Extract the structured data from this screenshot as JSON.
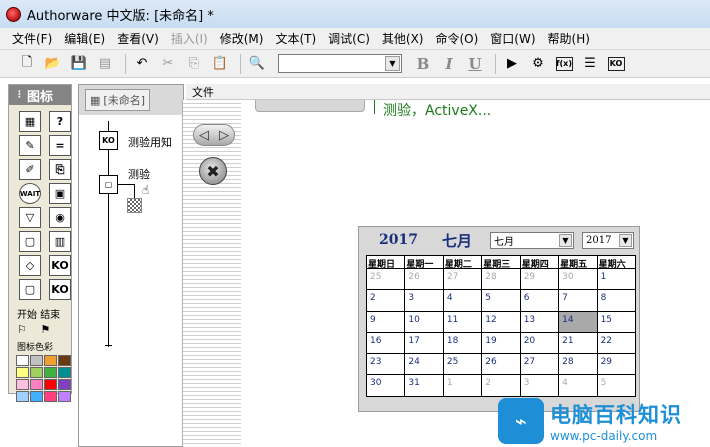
{
  "window": {
    "title": "Authorware 中文版: [未命名] *"
  },
  "menu": [
    {
      "label": "文件(F)",
      "enabled": true
    },
    {
      "label": "编辑(E)",
      "enabled": true
    },
    {
      "label": "查看(V)",
      "enabled": true
    },
    {
      "label": "插入(I)",
      "enabled": false
    },
    {
      "label": "修改(M)",
      "enabled": true
    },
    {
      "label": "文本(T)",
      "enabled": true
    },
    {
      "label": "调试(C)",
      "enabled": true
    },
    {
      "label": "其他(X)",
      "enabled": true
    },
    {
      "label": "命令(O)",
      "enabled": true
    },
    {
      "label": "窗口(W)",
      "enabled": true
    },
    {
      "label": "帮助(H)",
      "enabled": true
    }
  ],
  "toolbar": {
    "icons": [
      "new-file-icon",
      "open-file-icon",
      "save-all-icon",
      "import-icon",
      "undo-icon",
      "cut-icon",
      "copy-icon",
      "paste-icon",
      "find-icon"
    ],
    "style_select": "",
    "bold": "B",
    "italic": "I",
    "underline": "U",
    "right_icons": [
      "run-icon",
      "control-panel-icon",
      "functions-icon",
      "variables-icon",
      "knowledge-objects-icon"
    ],
    "fx_label": "f(x)",
    "ko_label": "KO"
  },
  "palette": {
    "title": "图标",
    "icons": [
      "display-icon",
      "motion-icon",
      "erase-icon",
      "wait-icon",
      "navigate-icon",
      "framework-icon",
      "decision-icon",
      "interaction-icon",
      "calculation-icon",
      "map-icon",
      "digital-movie-icon",
      "sound-icon",
      "video-icon",
      "knowledge-object-icon",
      "frame-icon",
      "ko-icon"
    ],
    "icon_glyphs": [
      "▦",
      "?",
      "✎",
      "=",
      "✐",
      "⎘",
      "WAIT",
      "▣",
      "▽",
      "◉",
      "▢",
      "▥",
      "◇",
      "KO",
      "▢",
      "KO"
    ],
    "start_label": "开始",
    "end_label": "结束",
    "color_label": "图标色彩",
    "colors": [
      "#ffffff",
      "#c0c0c0",
      "#f0a030",
      "#6a3a10",
      "#ffff80",
      "#a0d060",
      "#40b040",
      "#009090",
      "#ffc0e0",
      "#ff80c0",
      "#ff0000",
      "#8040c0",
      "#a0d0ff",
      "#40b0ff",
      "#ff4080",
      "#c080ff"
    ]
  },
  "design": {
    "tab": "[未命名]",
    "items": [
      {
        "label": "测验用知",
        "glyph": "KO"
      },
      {
        "label": "测验",
        "glyph": "▢"
      }
    ]
  },
  "file_panel_label": "文件",
  "presentation": {
    "top_text": "测验，ActiveX..."
  },
  "calendar": {
    "year": "2017",
    "month": "七月",
    "month_select": "七月",
    "year_select": "2017",
    "weekdays": [
      "星期日",
      "星期一",
      "星期二",
      "星期三",
      "星期四",
      "星期五",
      "星期六"
    ],
    "days": [
      {
        "d": "25",
        "other": true
      },
      {
        "d": "26",
        "other": true
      },
      {
        "d": "27",
        "other": true
      },
      {
        "d": "28",
        "other": true
      },
      {
        "d": "29",
        "other": true
      },
      {
        "d": "30",
        "other": true
      },
      {
        "d": "1",
        "other": false
      },
      {
        "d": "2",
        "other": false
      },
      {
        "d": "3",
        "other": false
      },
      {
        "d": "4",
        "other": false
      },
      {
        "d": "5",
        "other": false
      },
      {
        "d": "6",
        "other": false
      },
      {
        "d": "7",
        "other": false
      },
      {
        "d": "8",
        "other": false
      },
      {
        "d": "9",
        "other": false
      },
      {
        "d": "10",
        "other": false
      },
      {
        "d": "11",
        "other": false
      },
      {
        "d": "12",
        "other": false
      },
      {
        "d": "13",
        "other": false
      },
      {
        "d": "14",
        "other": false,
        "today": true
      },
      {
        "d": "15",
        "other": false
      },
      {
        "d": "16",
        "other": false
      },
      {
        "d": "17",
        "other": false
      },
      {
        "d": "18",
        "other": false
      },
      {
        "d": "19",
        "other": false
      },
      {
        "d": "20",
        "other": false
      },
      {
        "d": "21",
        "other": false
      },
      {
        "d": "22",
        "other": false
      },
      {
        "d": "23",
        "other": false
      },
      {
        "d": "24",
        "other": false
      },
      {
        "d": "25",
        "other": false
      },
      {
        "d": "26",
        "other": false
      },
      {
        "d": "27",
        "other": false
      },
      {
        "d": "28",
        "other": false
      },
      {
        "d": "29",
        "other": false
      },
      {
        "d": "30",
        "other": false
      },
      {
        "d": "31",
        "other": false
      },
      {
        "d": "1",
        "other": true
      },
      {
        "d": "2",
        "other": true
      },
      {
        "d": "3",
        "other": true
      },
      {
        "d": "4",
        "other": true
      },
      {
        "d": "5",
        "other": true
      }
    ]
  },
  "watermark": {
    "title": "电脑百科知识",
    "url": "www.pc-daily.com"
  }
}
